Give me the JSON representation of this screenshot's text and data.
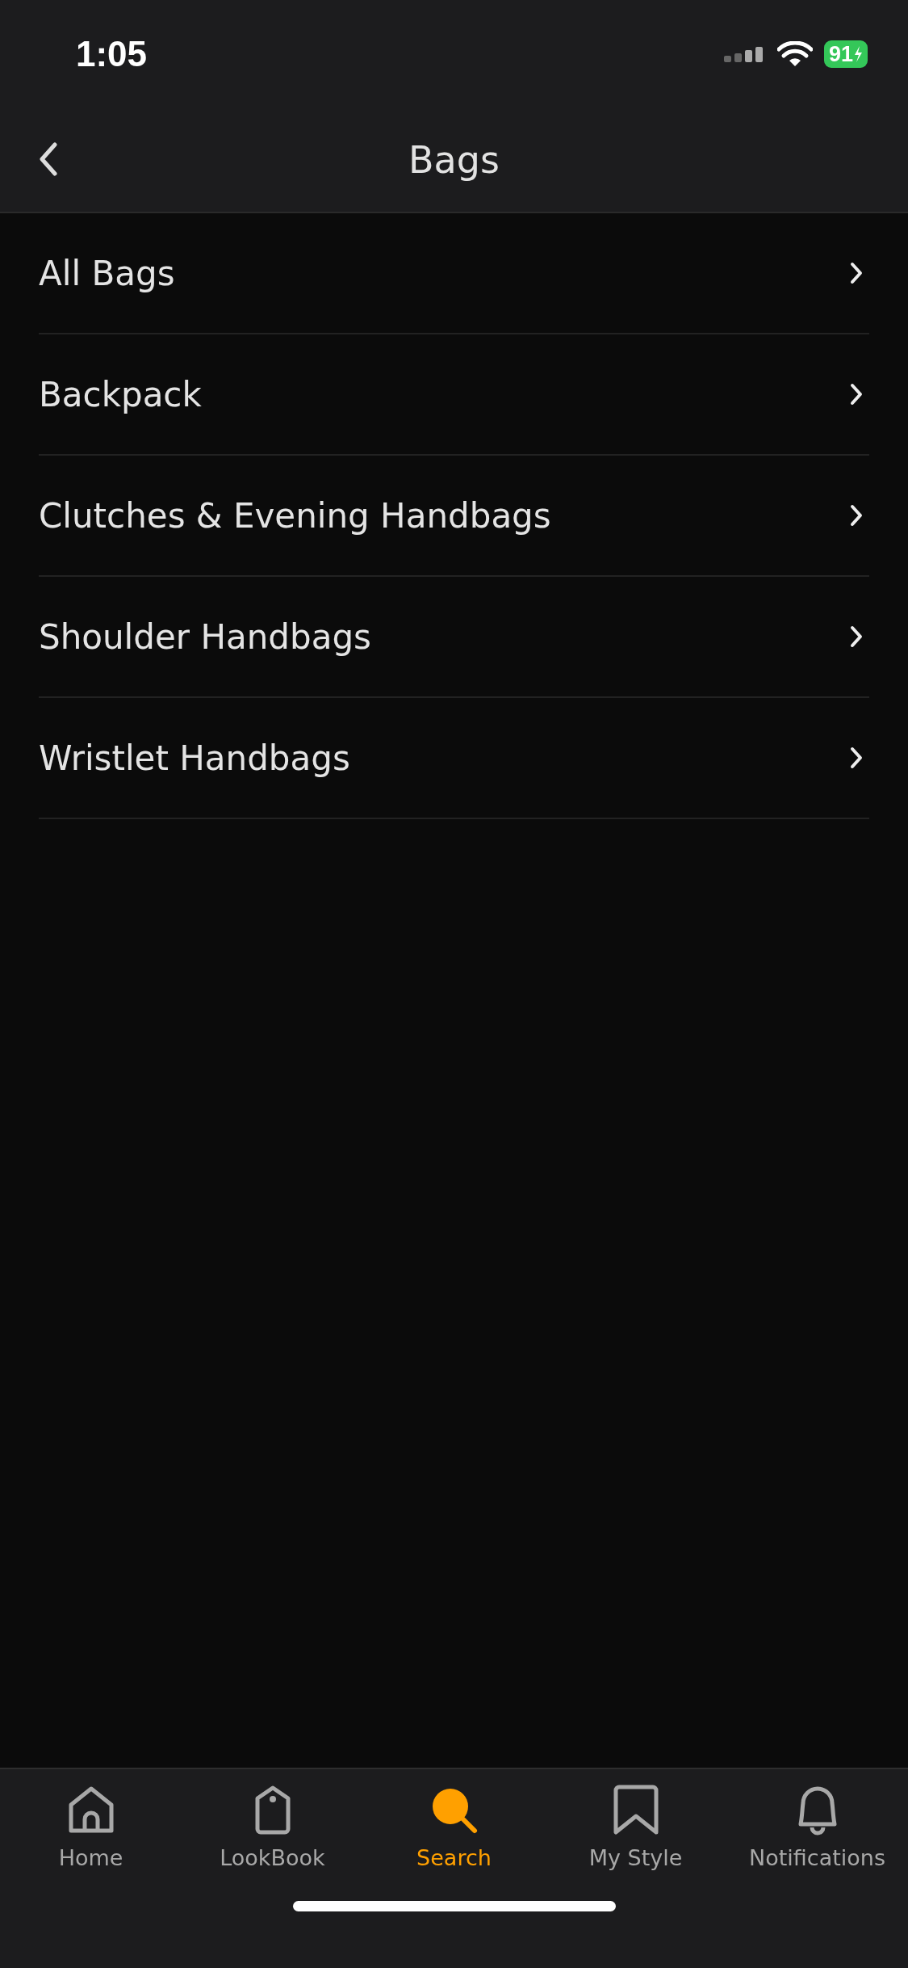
{
  "status_bar": {
    "time": "1:05",
    "battery": "91"
  },
  "nav": {
    "title": "Bags"
  },
  "items": [
    {
      "label": "All Bags"
    },
    {
      "label": "Backpack"
    },
    {
      "label": "Clutches & Evening Handbags"
    },
    {
      "label": "Shoulder Handbags"
    },
    {
      "label": "Wristlet Handbags"
    }
  ],
  "tabs": [
    {
      "label": "Home",
      "selected": false
    },
    {
      "label": "LookBook",
      "selected": false
    },
    {
      "label": "Search",
      "selected": true
    },
    {
      "label": "My Style",
      "selected": false
    },
    {
      "label": "Notifications",
      "selected": false
    }
  ]
}
